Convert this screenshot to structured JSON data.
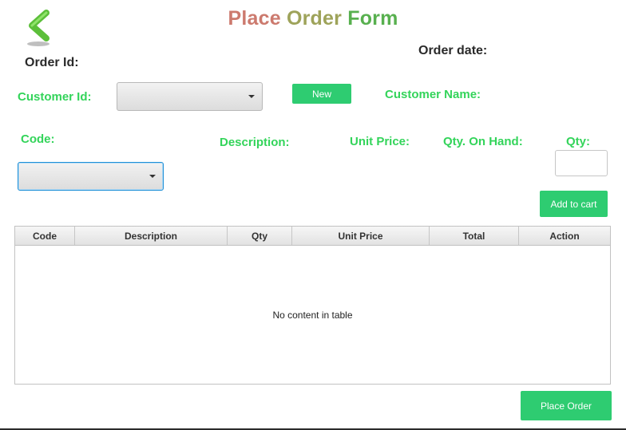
{
  "title": {
    "word1": "Place",
    "word2": "Order",
    "word3": "Form"
  },
  "labels": {
    "order_id": "Order Id:",
    "order_date": "Order date:",
    "customer_id": "Customer Id:",
    "customer_name": "Customer Name:",
    "code": "Code:",
    "description": "Description:",
    "unit_price": "Unit Price:",
    "qty_on_hand": "Qty. On Hand:",
    "qty": "Qty:"
  },
  "buttons": {
    "new": "New",
    "add_to_cart": "Add to cart",
    "place_order": "Place Order"
  },
  "inputs": {
    "qty_value": ""
  },
  "table": {
    "columns": [
      "Code",
      "Description",
      "Qty",
      "Unit Price",
      "Total",
      "Action"
    ],
    "empty_text": "No content in table"
  },
  "colors": {
    "accent_green": "#2ecc71",
    "label_green": "#33d45a",
    "title_red": "#cc7a6e",
    "title_olive": "#9ea35a",
    "title_green": "#58b04f"
  },
  "icons": {
    "back": "back-chevron-icon",
    "dropdown": "chevron-down-icon"
  }
}
